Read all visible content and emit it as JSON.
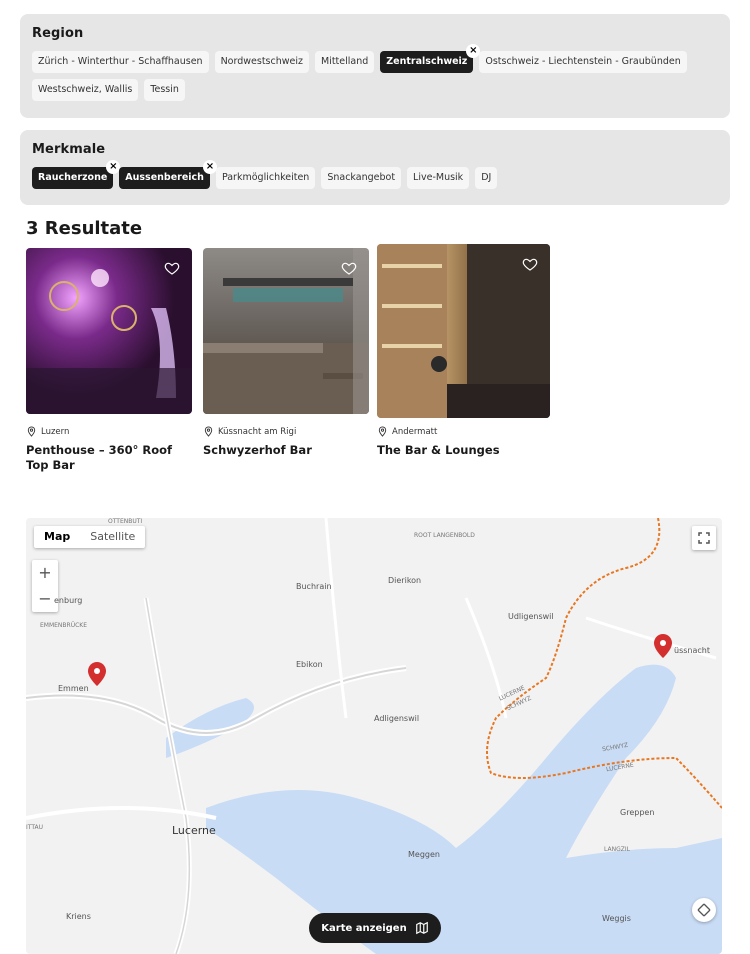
{
  "region": {
    "title": "Region",
    "chips": [
      {
        "label": "Zürich - Winterthur - Schaffhausen",
        "active": false
      },
      {
        "label": "Nordwestschweiz",
        "active": false
      },
      {
        "label": "Mittelland",
        "active": false
      },
      {
        "label": "Zentralschweiz",
        "active": true
      },
      {
        "label": "Ostschweiz - Liechtenstein - Graubünden",
        "active": false
      },
      {
        "label": "Westschweiz, Wallis",
        "active": false
      },
      {
        "label": "Tessin",
        "active": false
      }
    ]
  },
  "features": {
    "title": "Merkmale",
    "chips": [
      {
        "label": "Raucherzone",
        "active": true
      },
      {
        "label": "Aussenbereich",
        "active": true
      },
      {
        "label": "Parkmöglichkeiten",
        "active": false
      },
      {
        "label": "Snackangebot",
        "active": false
      },
      {
        "label": "Live-Musik",
        "active": false
      },
      {
        "label": "DJ",
        "active": false
      }
    ]
  },
  "results": {
    "title": "3 Resultate",
    "items": [
      {
        "location": "Luzern",
        "name": "Penthouse – 360° Roof Top Bar"
      },
      {
        "location": "Küssnacht am Rigi",
        "name": "Schwyzerhof Bar"
      },
      {
        "location": "Andermatt",
        "name": "The Bar & Lounges"
      }
    ]
  },
  "map": {
    "tabs": [
      "Map",
      "Satellite"
    ],
    "labels": {
      "buchrain": "Buchrain",
      "dierikon": "Dierikon",
      "udligenswil": "Udligenswil",
      "ebikon": "Ebikon",
      "adligenswil": "Adligenswil",
      "emmen": "Emmen",
      "lucerne": "Lucerne",
      "meggen": "Meggen",
      "greppen": "Greppen",
      "weggis": "Weggis",
      "kriens": "Kriens",
      "kussnacht": "üssnacht",
      "rothenburg": "enburg",
      "emmenbrucke": "EMMENBRÜCKE",
      "ottenbuti": "OTTENBÜTI",
      "root": "ROOT\nLANGENBOLD",
      "langzil": "LANGZIL",
      "ittau": "ITTAU",
      "border_lucerne": "LUCERNE",
      "border_schwyz": "SCHWYZ",
      "border_schwyz2": "SCHWYZ",
      "border_lucerne2": "LUCERNE"
    },
    "show_map_label": "Karte anzeigen"
  },
  "colors": {
    "accent": "#1d1d1d",
    "panel": "#e6e6e6",
    "pin": "#d32f2f",
    "water": "#c9dcf5",
    "border": "#e87722"
  }
}
